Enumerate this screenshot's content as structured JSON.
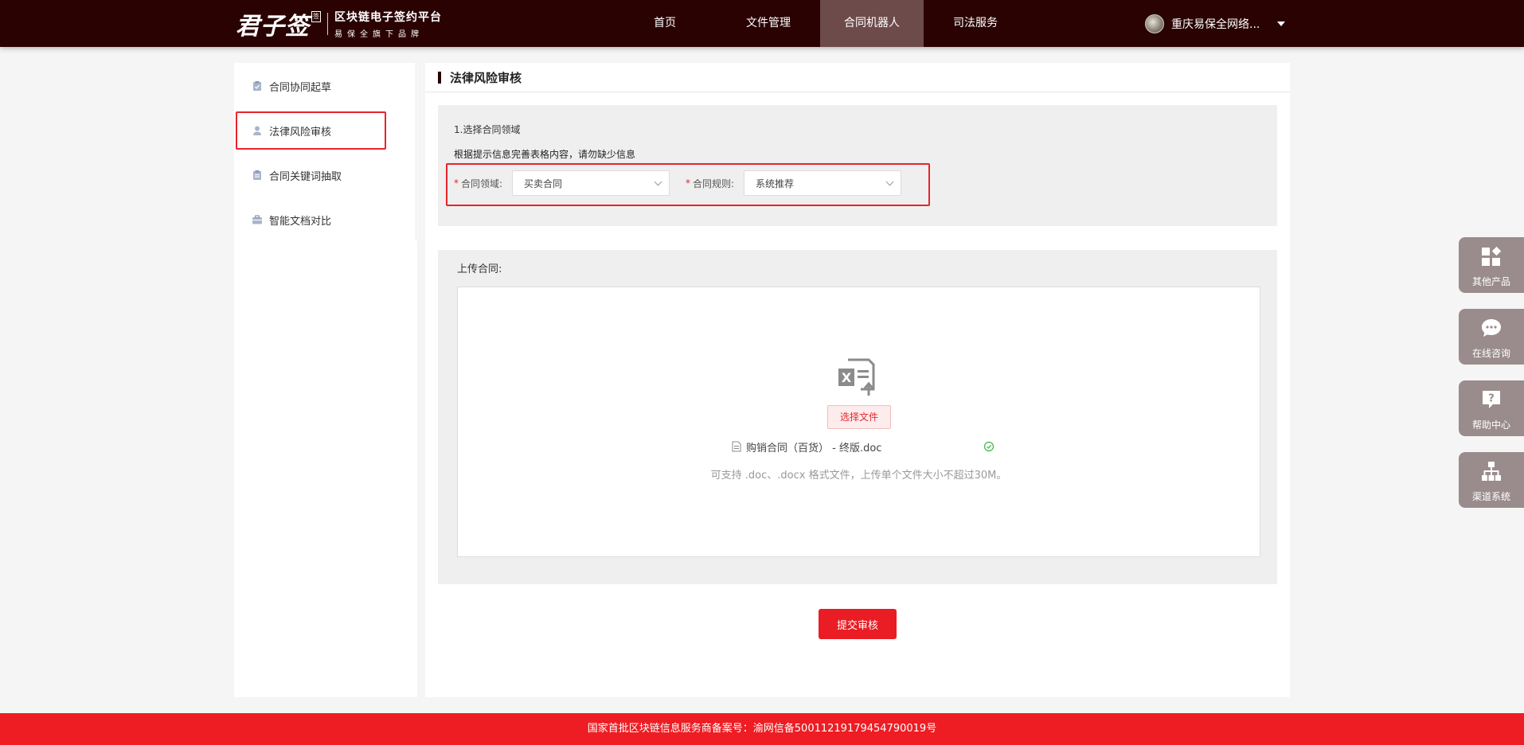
{
  "header": {
    "logo_text": "君子签",
    "logo_seal": "签",
    "logo_title": "区块链电子签约平台",
    "logo_subtitle": "易保全旗下品牌",
    "nav": [
      {
        "label": "首页"
      },
      {
        "label": "文件管理"
      },
      {
        "label": "合同机器人"
      },
      {
        "label": "司法服务"
      }
    ],
    "active_nav": "合同机器人",
    "user_name": "重庆易保全网络..."
  },
  "sidebar": {
    "items": [
      {
        "label": "合同协同起草",
        "icon": "clipboard-check-icon"
      },
      {
        "label": "法律风险审核",
        "icon": "user-stamp-icon"
      },
      {
        "label": "合同关键词抽取",
        "icon": "clipboard-list-icon"
      },
      {
        "label": "智能文档对比",
        "icon": "briefcase-icon"
      }
    ],
    "active_item": "法律风险审核"
  },
  "main": {
    "title": "法律风险审核",
    "step_title": "1.选择合同领域",
    "hint": "根据提示信息完善表格内容，请勿缺少信息",
    "fields": {
      "domain": {
        "required_mark": "*",
        "label": "合同领域:",
        "value": "买卖合同"
      },
      "rule": {
        "required_mark": "*",
        "label": "合同规则:",
        "value": "系统推荐"
      }
    },
    "upload": {
      "label": "上传合同:",
      "choose_button": "选择文件",
      "file_name": "购销合同（百货） - 终版.doc",
      "support_text": "可支持 .doc、.docx 格式文件，上传单个文件大小不超过30M。"
    },
    "submit_label": "提交审核"
  },
  "floating": [
    {
      "label": "其他产品",
      "icon": "grid-icon"
    },
    {
      "label": "在线咨询",
      "icon": "chat-icon"
    },
    {
      "label": "帮助中心",
      "icon": "help-icon"
    },
    {
      "label": "渠道系统",
      "icon": "sitemap-icon"
    }
  ],
  "footer": {
    "text": "国家首批区块链信息服务商备案号：渝网信备50011219179454790019号"
  },
  "colors": {
    "header_bg": "#2a0202",
    "accent_red": "#ea1c24",
    "footer_red": "#ee1d23",
    "active_nav_bg": "#6e4b4b",
    "floating_bg": "#9a8c8c"
  }
}
